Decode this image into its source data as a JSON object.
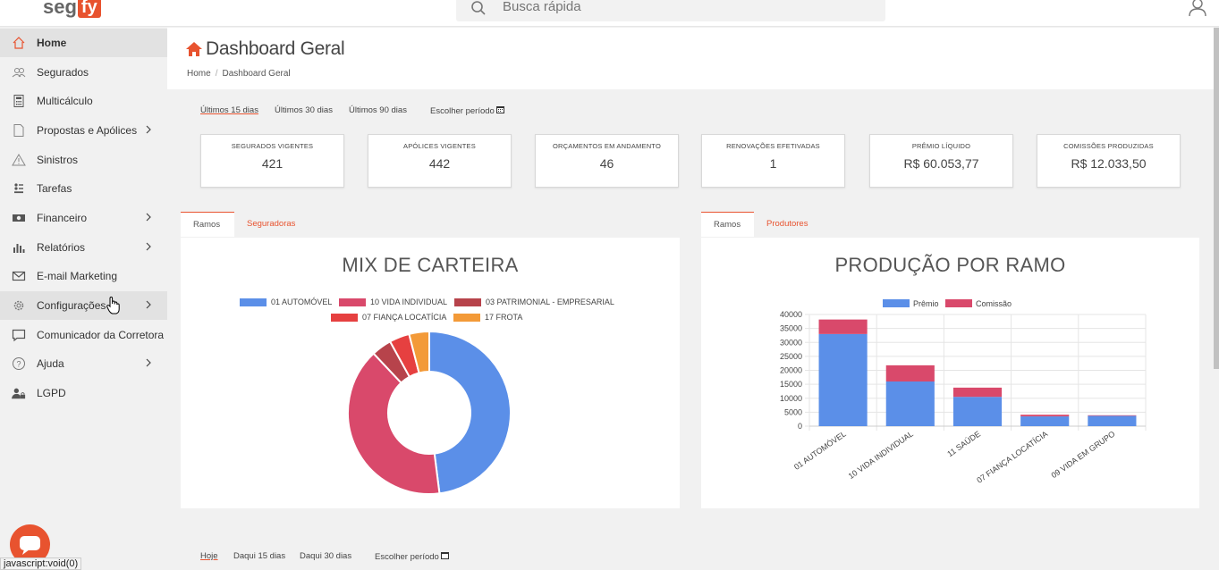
{
  "app": {
    "logo_left": "seg",
    "logo_right": "fy"
  },
  "search": {
    "placeholder": "Busca rápida"
  },
  "sidebar": {
    "items": [
      {
        "label": "Home",
        "icon": "home-icon"
      },
      {
        "label": "Segurados",
        "icon": "users-icon"
      },
      {
        "label": "Multicálculo",
        "icon": "calculator-icon"
      },
      {
        "label": "Propostas e Apólices",
        "icon": "document-icon"
      },
      {
        "label": "Sinistros",
        "icon": "warning-icon"
      },
      {
        "label": "Tarefas",
        "icon": "tasks-icon"
      },
      {
        "label": "Financeiro",
        "icon": "money-icon"
      },
      {
        "label": "Relatórios",
        "icon": "bar-chart-icon"
      },
      {
        "label": "E-mail Marketing",
        "icon": "email-icon"
      },
      {
        "label": "Configurações",
        "icon": "gear-icon"
      },
      {
        "label": "Comunicador da Corretora",
        "icon": "chat-icon"
      },
      {
        "label": "Ajuda",
        "icon": "help-icon"
      },
      {
        "label": "LGPD",
        "icon": "person-lock-icon"
      }
    ]
  },
  "header": {
    "title": "Dashboard Geral",
    "breadcrumb": [
      "Home",
      "Dashboard Geral"
    ]
  },
  "period_filters": {
    "options": [
      "Últimos 15 dias",
      "Últimos 30 dias",
      "Últimos 90 dias",
      "Escolher período"
    ],
    "selected": "Últimos 15 dias"
  },
  "kpis": [
    {
      "title": "SEGURADOS VIGENTES",
      "value": "421"
    },
    {
      "title": "APÓLICES VIGENTES",
      "value": "442"
    },
    {
      "title": "ORÇAMENTOS EM ANDAMENTO",
      "value": "46"
    },
    {
      "title": "RENOVAÇÕES EFETIVADAS",
      "value": "1"
    },
    {
      "title": "PRÊMIO LÍQUIDO",
      "value": "R$ 60.053,77"
    },
    {
      "title": "COMISSÕES PRODUZIDAS",
      "value": "R$ 12.033,50"
    }
  ],
  "left_panel": {
    "tabs": [
      "Ramos",
      "Seguradoras"
    ],
    "active_tab": "Ramos"
  },
  "right_panel": {
    "tabs": [
      "Ramos",
      "Produtores"
    ],
    "active_tab": "Ramos"
  },
  "bottom_filters": {
    "options": [
      "Hoje",
      "Daqui 15 dias",
      "Daqui 30 dias",
      "Escolher período"
    ],
    "selected": "Hoje"
  },
  "statusbar": {
    "text": "javascript:void(0)"
  },
  "colors": {
    "brand": "#e8532f",
    "blue": "#5b8fe8",
    "pink": "#d9496b"
  },
  "chart_data": [
    {
      "type": "pie",
      "title": "MIX DE CARTEIRA",
      "donut": true,
      "categories": [
        "01 AUTOMÓVEL",
        "10 VIDA INDIVIDUAL",
        "03 PATRIMONIAL - EMPRESARIAL",
        "07 FIANÇA LOCATÍCIA",
        "17 FROTA"
      ],
      "values": [
        48,
        40,
        4,
        4,
        4
      ],
      "colors": [
        "#5b8fe8",
        "#d9496b",
        "#b7434b",
        "#e64040",
        "#f39a38"
      ],
      "legend": "top"
    },
    {
      "type": "bar",
      "stacked": true,
      "title": "PRODUÇÃO POR RAMO",
      "categories": [
        "01 AUTOMÓVEL",
        "10 VIDA INDIVIDUAL",
        "11 SAÚDE",
        "07 FIANÇA LOCATÍCIA",
        "09 VIDA EM GRUPO"
      ],
      "series": [
        {
          "name": "Prêmio",
          "color": "#5b8fe8",
          "values": [
            33000,
            16000,
            10500,
            3500,
            3700
          ]
        },
        {
          "name": "Comissão",
          "color": "#d9496b",
          "values": [
            5200,
            5800,
            3300,
            600,
            200
          ]
        }
      ],
      "ylim": [
        0,
        40000
      ],
      "yticks": [
        0,
        5000,
        10000,
        15000,
        20000,
        25000,
        30000,
        35000,
        40000
      ],
      "legend": "top",
      "grid": true
    }
  ]
}
